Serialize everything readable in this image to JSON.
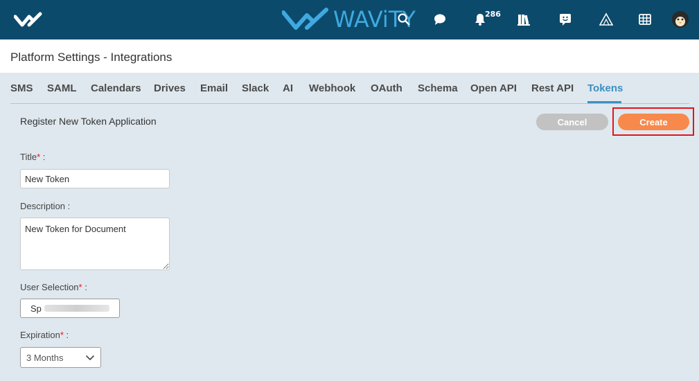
{
  "header": {
    "brand_name": "WAViTY",
    "notification_count": "286",
    "icons": [
      "check-logo-icon",
      "brand-logo-icon",
      "search-icon",
      "chat-icon",
      "bell-icon",
      "library-icon",
      "feedback-icon",
      "triangle-icon",
      "grid-icon",
      "avatar"
    ]
  },
  "page": {
    "title": "Platform Settings - Integrations"
  },
  "tabs": [
    {
      "label": "SMS"
    },
    {
      "label": "SAML"
    },
    {
      "label": "Calendars"
    },
    {
      "label": "Drives"
    },
    {
      "label": "Email"
    },
    {
      "label": "Slack"
    },
    {
      "label": "AI"
    },
    {
      "label": "Webhook"
    },
    {
      "label": "OAuth"
    },
    {
      "label": "Schema"
    },
    {
      "label": "Open API"
    },
    {
      "label": "Rest API"
    },
    {
      "label": "Tokens"
    }
  ],
  "active_tab": "Tokens",
  "form": {
    "heading": "Register New Token Application",
    "cancel_label": "Cancel",
    "create_label": "Create",
    "title_label": "Title",
    "title_value": "New Token",
    "description_label": "Description :",
    "description_value": "New Token for Document",
    "user_selection_label": "User Selection",
    "user_selection_value": "Sp",
    "expiration_label": "Expiration",
    "expiration_value": "3 Months",
    "required_mark": "*",
    "colon": " :"
  },
  "colors": {
    "header_bg": "#0c4a6b",
    "accent_blue": "#3b8fc2",
    "create_orange": "#f7894c",
    "highlight_red": "#e3141b"
  }
}
